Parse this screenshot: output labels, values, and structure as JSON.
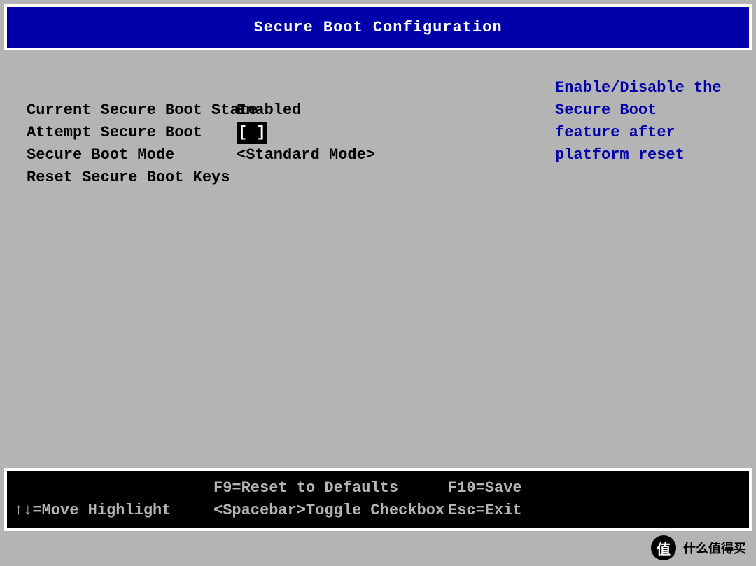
{
  "header": {
    "title": "Secure Boot Configuration"
  },
  "config": {
    "rows": [
      {
        "label": "Current Secure Boot State",
        "value": "Enabled"
      },
      {
        "label": "Attempt Secure Boot",
        "value": "[ ]",
        "highlighted": true
      },
      {
        "label": "Secure Boot Mode",
        "value": "<Standard Mode>"
      },
      {
        "label": "Reset Secure Boot Keys",
        "value": ""
      }
    ],
    "help_text": "Enable/Disable the Secure Boot feature after platform reset"
  },
  "footer": {
    "cells": [
      "",
      "F9=Reset to Defaults",
      "F10=Save",
      "↑↓=Move Highlight",
      "<Spacebar>Toggle Checkbox",
      "Esc=Exit"
    ]
  },
  "watermark": {
    "icon": "值",
    "text": "什么值得买"
  }
}
